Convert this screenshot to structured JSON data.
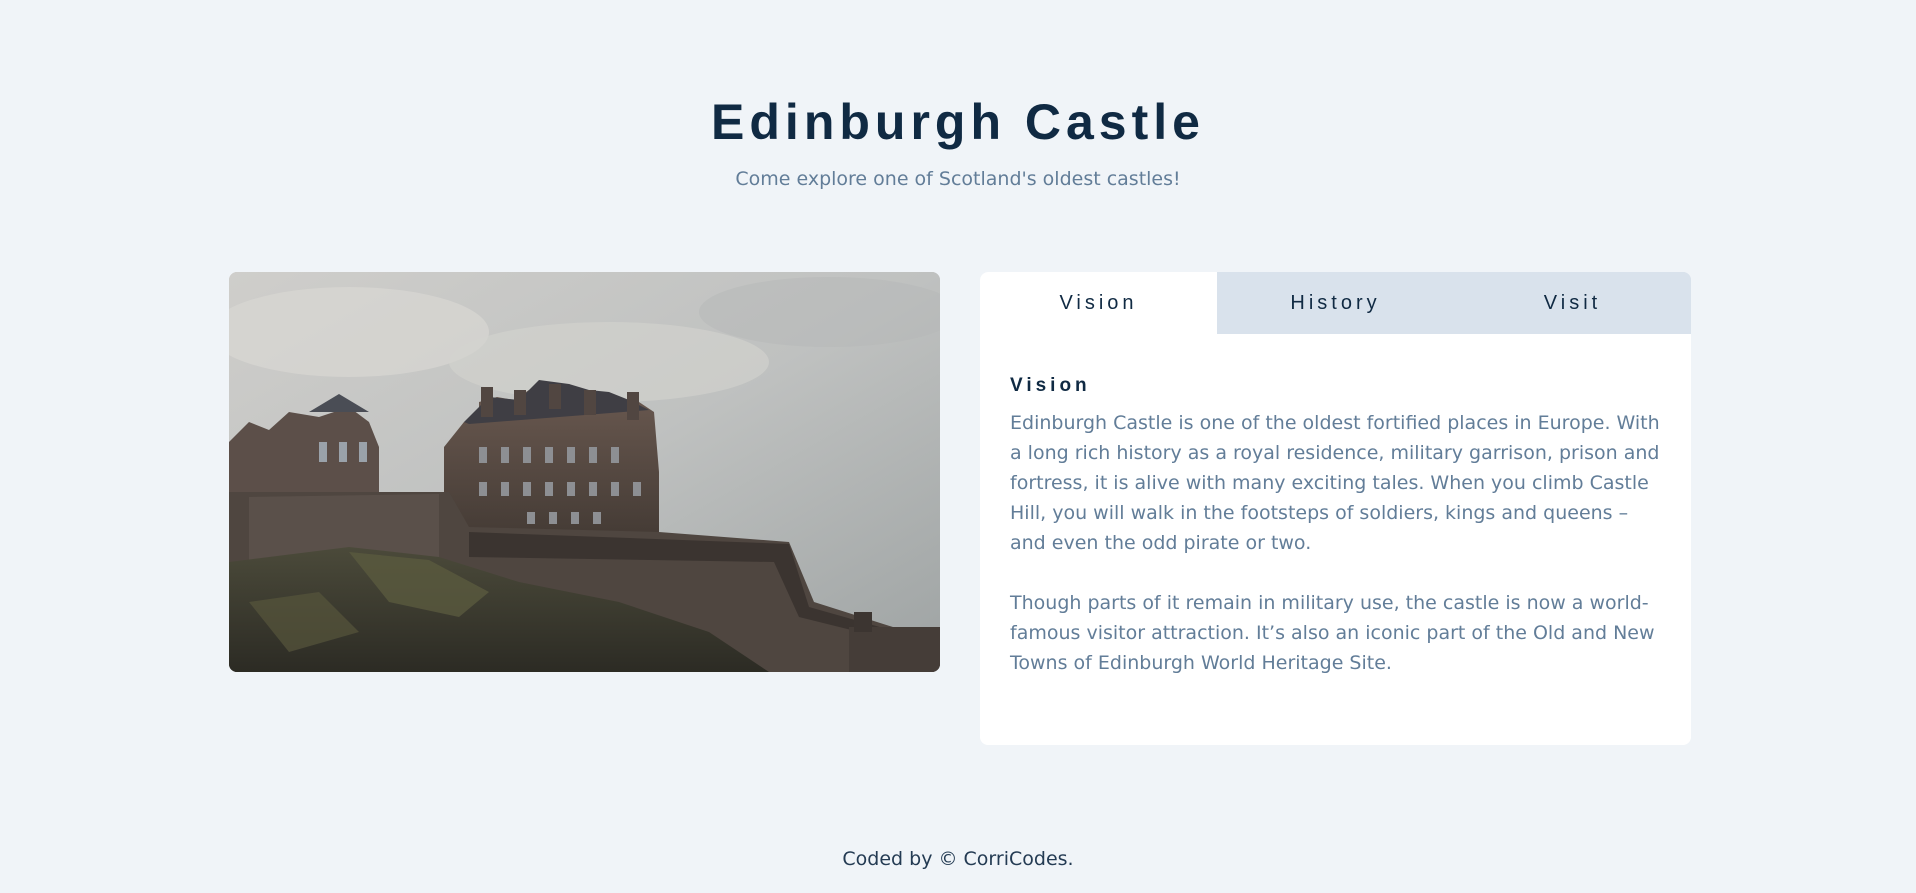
{
  "header": {
    "title": "Edinburgh Castle",
    "subtitle": "Come explore one of Scotland's oldest castles!"
  },
  "image": {
    "subject": "edinburgh-castle-photo"
  },
  "tabs": [
    {
      "label": "Vision",
      "active": true
    },
    {
      "label": "History",
      "active": false
    },
    {
      "label": "Visit",
      "active": false
    }
  ],
  "panel": {
    "heading": "Vision",
    "paragraphs": [
      "Edinburgh Castle is one of the oldest fortified places in Europe. With a long rich history as a royal residence, military garrison, prison and fortress, it is alive with many exciting tales. When you climb Castle Hill, you will walk in the footsteps of soldiers, kings and queens – and even the odd pirate or two.",
      "Though parts of it remain in military use, the castle is now a world-famous visitor attraction. It’s also an iconic part of the Old and New Towns of Edinburgh World Heritage Site."
    ]
  },
  "footer": {
    "text": "Coded by © CorriCodes."
  },
  "colors": {
    "background": "#f0f4f8",
    "title": "#102a43",
    "body_text": "#627d98",
    "tab_inactive": "#d9e2ec",
    "card": "#ffffff"
  }
}
